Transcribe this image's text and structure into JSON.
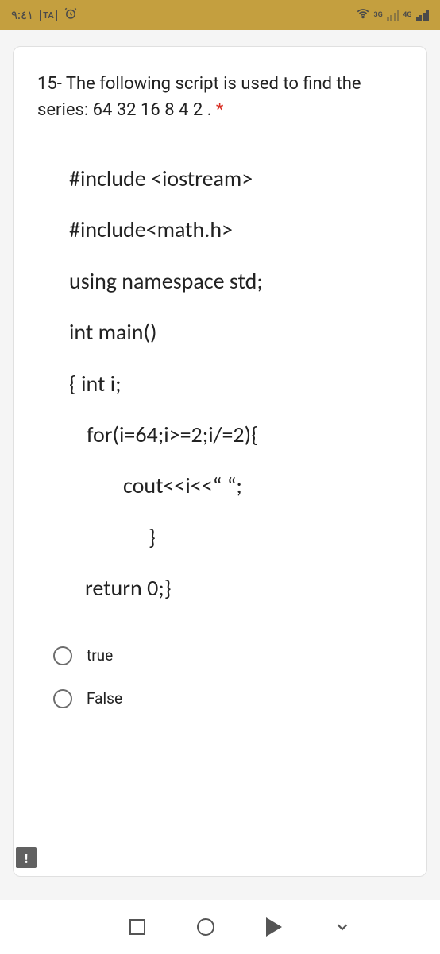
{
  "status": {
    "time": "٩:٤١",
    "langBadge": "TA",
    "net1": "3G",
    "net2": "4G"
  },
  "question": {
    "title": "15- The following script is used to find the series: 64 32 16 8 4 2 .",
    "required": "*"
  },
  "code": {
    "l1": "#include <iostream>",
    "l2": "#include<math.h>",
    "l3": "using namespace std;",
    "l4": "int main()",
    "l5": "{ int i;",
    "l6": "for(i=64;i>=2;i/=2){",
    "l7": "cout<<i<<“ “;",
    "l8": "}",
    "l9": "return 0;}"
  },
  "options": {
    "opt1": "true",
    "opt2": "False"
  },
  "feedbackGlyph": "!"
}
